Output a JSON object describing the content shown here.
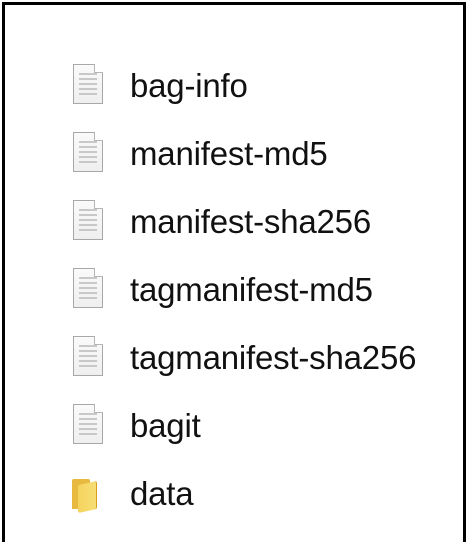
{
  "window": {
    "title": ""
  },
  "file_list": {
    "items": [
      {
        "label": "bag-info",
        "icon": "document-icon",
        "type": "file"
      },
      {
        "label": "manifest-md5",
        "icon": "document-icon",
        "type": "file"
      },
      {
        "label": "manifest-sha256",
        "icon": "document-icon",
        "type": "file"
      },
      {
        "label": "tagmanifest-md5",
        "icon": "document-icon",
        "type": "file"
      },
      {
        "label": "tagmanifest-sha256",
        "icon": "document-icon",
        "type": "file"
      },
      {
        "label": "bagit",
        "icon": "document-icon",
        "type": "file"
      },
      {
        "label": "data",
        "icon": "folder-icon",
        "type": "folder"
      }
    ]
  },
  "colors": {
    "text": "#111111",
    "border": "#000000",
    "folder_yellow": "#f5d45e"
  }
}
